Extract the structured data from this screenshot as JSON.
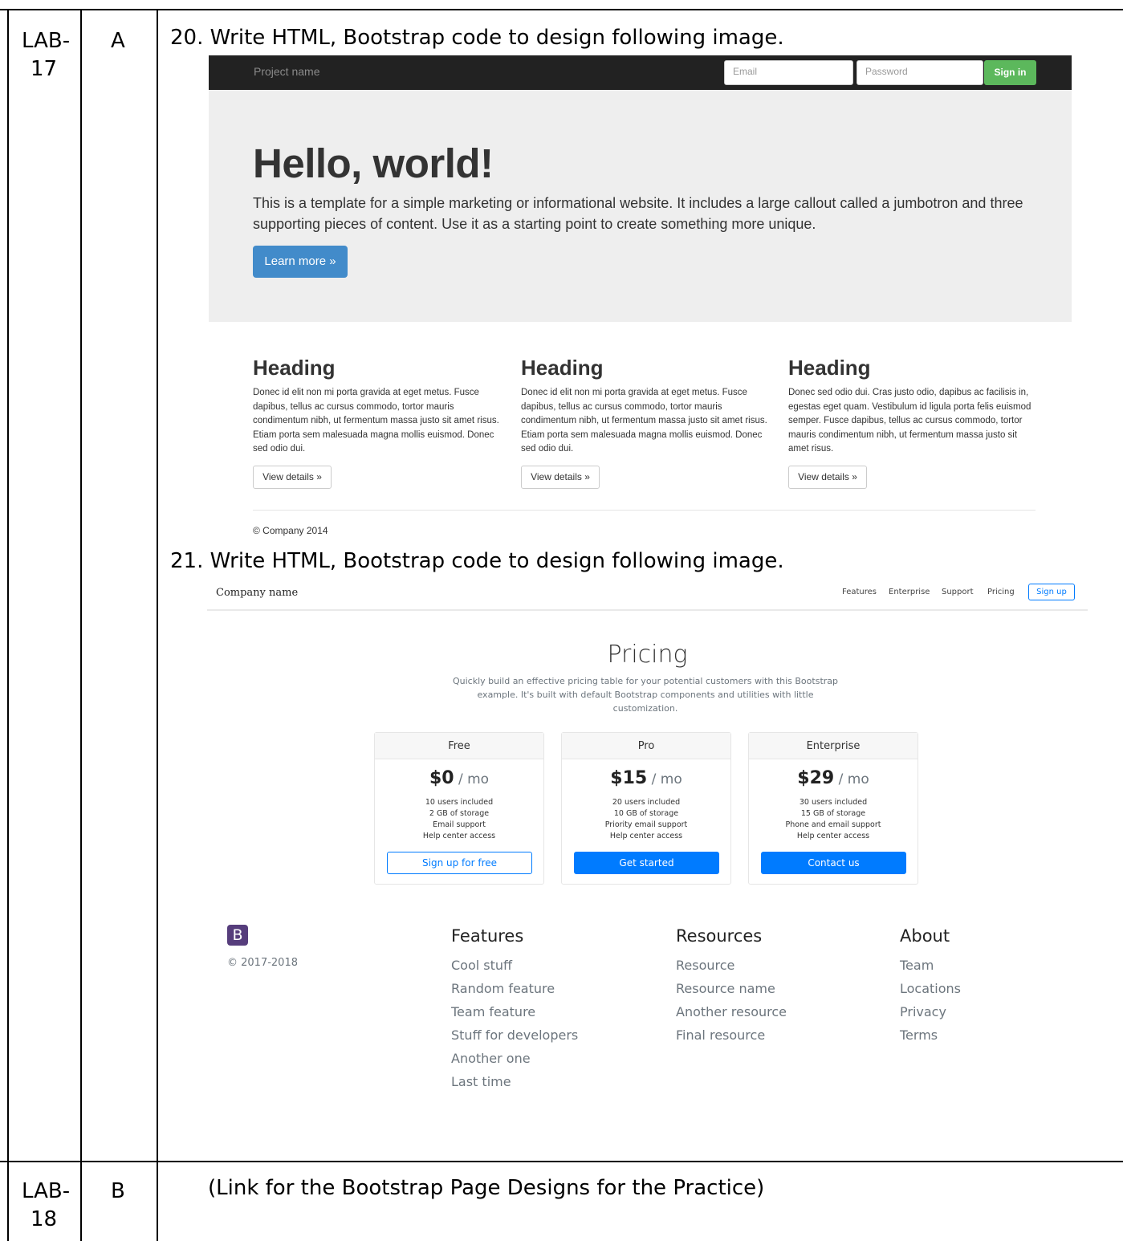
{
  "table": {
    "row1": {
      "lab_line1": "LAB-",
      "lab_line2": "17",
      "part": "A"
    },
    "row2": {
      "lab_line1": "LAB-",
      "lab_line2": "18",
      "part": "B",
      "text": "(Link for the Bootstrap Page Designs for the Practice)"
    }
  },
  "q20": "20. Write HTML, Bootstrap code to design following image.",
  "q21": "21. Write HTML, Bootstrap code to design following image.",
  "shot1": {
    "brand": "Project name",
    "email_placeholder": "Email",
    "password_placeholder": "Password",
    "signin": "Sign in",
    "jumbo_title": "Hello, world!",
    "jumbo_text": "This is a template for a simple marketing or informational website. It includes a large callout called a jumbotron and three supporting pieces of content. Use it as a starting point to create something more unique.",
    "learn_more": "Learn more »",
    "columns": [
      {
        "heading": "Heading",
        "text": "Donec id elit non mi porta gravida at eget metus. Fusce dapibus, tellus ac cursus commodo, tortor mauris condimentum nibh, ut fermentum massa justo sit amet risus. Etiam porta sem malesuada magna mollis euismod. Donec sed odio dui.",
        "button": "View details »"
      },
      {
        "heading": "Heading",
        "text": "Donec id elit non mi porta gravida at eget metus. Fusce dapibus, tellus ac cursus commodo, tortor mauris condimentum nibh, ut fermentum massa justo sit amet risus. Etiam porta sem malesuada magna mollis euismod. Donec sed odio dui.",
        "button": "View details »"
      },
      {
        "heading": "Heading",
        "text": "Donec sed odio dui. Cras justo odio, dapibus ac facilisis in, egestas eget quam. Vestibulum id ligula porta felis euismod semper. Fusce dapibus, tellus ac cursus commodo, tortor mauris condimentum nibh, ut fermentum massa justo sit amet risus.",
        "button": "View details »"
      }
    ],
    "footer": "© Company 2014"
  },
  "shot2": {
    "brand": "Company name",
    "nav": [
      "Features",
      "Enterprise",
      "Support",
      "Pricing"
    ],
    "signup": "Sign up",
    "title": "Pricing",
    "lead": "Quickly build an effective pricing table for your potential customers with this Bootstrap example. It's built with default Bootstrap components and utilities with little customization.",
    "cards": [
      {
        "name": "Free",
        "price": "$0",
        "per": " / mo",
        "features": [
          "10 users included",
          "2 GB of storage",
          "Email support",
          "Help center access"
        ],
        "button": "Sign up for free"
      },
      {
        "name": "Pro",
        "price": "$15",
        "per": " / mo",
        "features": [
          "20 users included",
          "10 GB of storage",
          "Priority email support",
          "Help center access"
        ],
        "button": "Get started"
      },
      {
        "name": "Enterprise",
        "price": "$29",
        "per": " / mo",
        "features": [
          "30 users included",
          "15 GB of storage",
          "Phone and email support",
          "Help center access"
        ],
        "button": "Contact us"
      }
    ],
    "logo": "B",
    "copyright": "© 2017-2018",
    "footer_cols": [
      {
        "title": "Features",
        "items": [
          "Cool stuff",
          "Random feature",
          "Team feature",
          "Stuff for developers",
          "Another one",
          "Last time"
        ]
      },
      {
        "title": "Resources",
        "items": [
          "Resource",
          "Resource name",
          "Another resource",
          "Final resource"
        ]
      },
      {
        "title": "About",
        "items": [
          "Team",
          "Locations",
          "Privacy",
          "Terms"
        ]
      }
    ]
  },
  "colors": {
    "navbar_dark": "#222222",
    "signin_green": "#5cb85c",
    "learn_blue": "#428bca",
    "bootstrap_blue": "#007bff",
    "bootstrap_purple": "#563d7c",
    "jumbotron_gray": "#eeeeee"
  }
}
